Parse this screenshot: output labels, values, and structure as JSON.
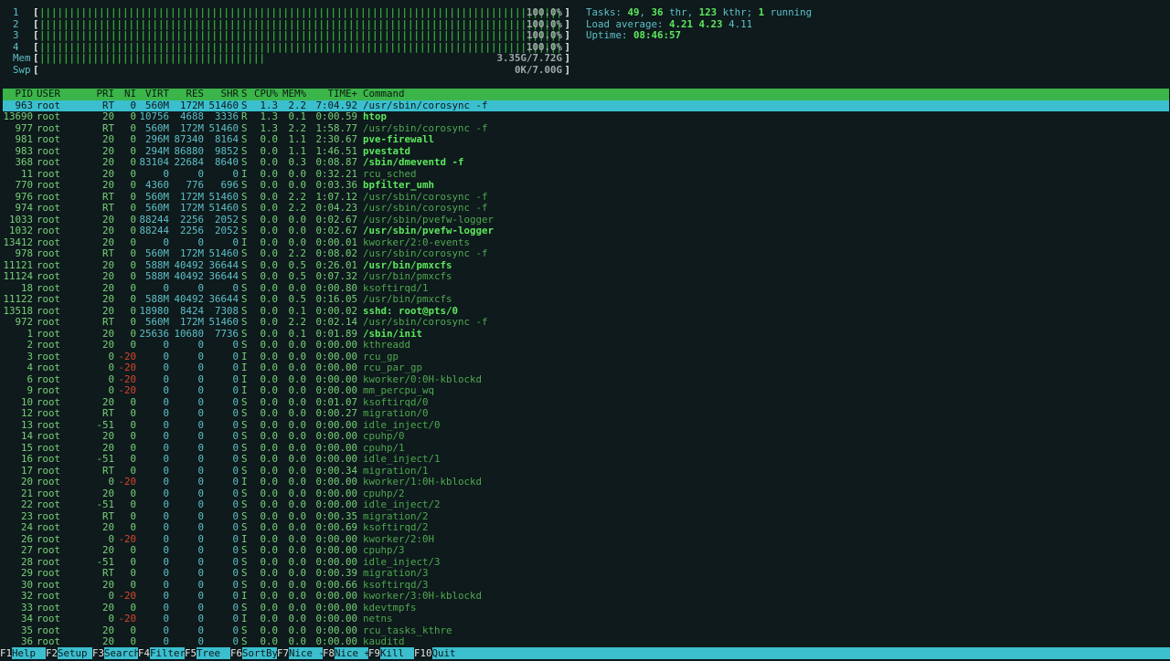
{
  "meters": [
    {
      "label": "1",
      "fraction": 1.0,
      "text": "100.0%",
      "bar_color": "#47d247"
    },
    {
      "label": "2",
      "fraction": 1.0,
      "text": "100.0%",
      "bar_color": "#47d247"
    },
    {
      "label": "3",
      "fraction": 1.0,
      "text": "100.0%",
      "bar_color": "#47d247"
    },
    {
      "label": "4",
      "fraction": 1.0,
      "text": "100.0%",
      "bar_color": "#47d247"
    },
    {
      "label": "Mem",
      "fraction": 0.434,
      "text": "3.35G/7.72G",
      "bar_color": "#47d247"
    },
    {
      "label": "Swp",
      "fraction": 0.0,
      "text": "0K/7.00G",
      "bar_color": "#d8452b"
    }
  ],
  "info": {
    "tasks_label": "Tasks: ",
    "tasks": "49",
    "thr_sep": ", ",
    "thr": "36",
    "thr_label": " thr, ",
    "kthr": "123",
    "kthr_label": " kthr; ",
    "running": "1",
    "running_label": " running",
    "load_label": "Load average: ",
    "load1": "4.21",
    "load5": "4.23",
    "load15": "4.11",
    "uptime_label": "Uptime: ",
    "uptime": "08:46:57"
  },
  "columns": {
    "pid": "PID",
    "user": "USER",
    "pri": "PRI",
    "ni": "NI",
    "virt": "VIRT",
    "res": "RES",
    "shr": "SHR",
    "s": "S",
    "cpu": "CPU%",
    "mem": "MEM%",
    "time": "TIME+",
    "cmd": "Command"
  },
  "processes": [
    {
      "pid": "963",
      "user": "root",
      "pri": "RT",
      "ni": "0",
      "virt": "560M",
      "res": "172M",
      "shr": "51460",
      "s": "S",
      "cpu": "1.3",
      "mem": "2.2",
      "time": "7:04.92",
      "cmd": "/usr/sbin/corosync -f",
      "style": "normal",
      "selected": true
    },
    {
      "pid": "13690",
      "user": "root",
      "pri": "20",
      "ni": "0",
      "virt": "10756",
      "res": "4688",
      "shr": "3336",
      "s": "R",
      "cpu": "1.3",
      "mem": "0.1",
      "time": "0:00.59",
      "cmd": "htop",
      "style": "bright"
    },
    {
      "pid": "977",
      "user": "root",
      "pri": "RT",
      "ni": "0",
      "virt": "560M",
      "res": "172M",
      "shr": "51460",
      "s": "S",
      "cpu": "1.3",
      "mem": "2.2",
      "time": "1:58.77",
      "cmd": "/usr/sbin/corosync -f",
      "style": "dim"
    },
    {
      "pid": "981",
      "user": "root",
      "pri": "20",
      "ni": "0",
      "virt": "296M",
      "res": "87340",
      "shr": "8164",
      "s": "S",
      "cpu": "0.0",
      "mem": "1.1",
      "time": "2:30.67",
      "cmd": "pve-firewall",
      "style": "bright"
    },
    {
      "pid": "983",
      "user": "root",
      "pri": "20",
      "ni": "0",
      "virt": "294M",
      "res": "86880",
      "shr": "9852",
      "s": "S",
      "cpu": "0.0",
      "mem": "1.1",
      "time": "1:46.51",
      "cmd": "pvestatd",
      "style": "bright"
    },
    {
      "pid": "368",
      "user": "root",
      "pri": "20",
      "ni": "0",
      "virt": "83104",
      "res": "22684",
      "shr": "8640",
      "s": "S",
      "cpu": "0.0",
      "mem": "0.3",
      "time": "0:08.87",
      "cmd": "/sbin/dmeventd -f",
      "style": "bright"
    },
    {
      "pid": "11",
      "user": "root",
      "pri": "20",
      "ni": "0",
      "virt": "0",
      "res": "0",
      "shr": "0",
      "s": "I",
      "cpu": "0.0",
      "mem": "0.0",
      "time": "0:32.21",
      "cmd": "rcu_sched",
      "style": "dim"
    },
    {
      "pid": "770",
      "user": "root",
      "pri": "20",
      "ni": "0",
      "virt": "4360",
      "res": "776",
      "shr": "696",
      "s": "S",
      "cpu": "0.0",
      "mem": "0.0",
      "time": "0:03.36",
      "cmd": "bpfilter_umh",
      "style": "bright"
    },
    {
      "pid": "976",
      "user": "root",
      "pri": "RT",
      "ni": "0",
      "virt": "560M",
      "res": "172M",
      "shr": "51460",
      "s": "S",
      "cpu": "0.0",
      "mem": "2.2",
      "time": "1:07.12",
      "cmd": "/usr/sbin/corosync -f",
      "style": "dim"
    },
    {
      "pid": "974",
      "user": "root",
      "pri": "RT",
      "ni": "0",
      "virt": "560M",
      "res": "172M",
      "shr": "51460",
      "s": "S",
      "cpu": "0.0",
      "mem": "2.2",
      "time": "0:04.23",
      "cmd": "/usr/sbin/corosync -f",
      "style": "dim"
    },
    {
      "pid": "1033",
      "user": "root",
      "pri": "20",
      "ni": "0",
      "virt": "88244",
      "res": "2256",
      "shr": "2052",
      "s": "S",
      "cpu": "0.0",
      "mem": "0.0",
      "time": "0:02.67",
      "cmd": "/usr/sbin/pvefw-logger",
      "style": "dim"
    },
    {
      "pid": "1032",
      "user": "root",
      "pri": "20",
      "ni": "0",
      "virt": "88244",
      "res": "2256",
      "shr": "2052",
      "s": "S",
      "cpu": "0.0",
      "mem": "0.0",
      "time": "0:02.67",
      "cmd": "/usr/sbin/pvefw-logger",
      "style": "bright"
    },
    {
      "pid": "13412",
      "user": "root",
      "pri": "20",
      "ni": "0",
      "virt": "0",
      "res": "0",
      "shr": "0",
      "s": "I",
      "cpu": "0.0",
      "mem": "0.0",
      "time": "0:00.01",
      "cmd": "kworker/2:0-events",
      "style": "dim"
    },
    {
      "pid": "978",
      "user": "root",
      "pri": "RT",
      "ni": "0",
      "virt": "560M",
      "res": "172M",
      "shr": "51460",
      "s": "S",
      "cpu": "0.0",
      "mem": "2.2",
      "time": "0:08.02",
      "cmd": "/usr/sbin/corosync -f",
      "style": "dim"
    },
    {
      "pid": "11121",
      "user": "root",
      "pri": "20",
      "ni": "0",
      "virt": "588M",
      "res": "40492",
      "shr": "36644",
      "s": "S",
      "cpu": "0.0",
      "mem": "0.5",
      "time": "0:26.01",
      "cmd": "/usr/bin/pmxcfs",
      "style": "bright"
    },
    {
      "pid": "11124",
      "user": "root",
      "pri": "20",
      "ni": "0",
      "virt": "588M",
      "res": "40492",
      "shr": "36644",
      "s": "S",
      "cpu": "0.0",
      "mem": "0.5",
      "time": "0:07.32",
      "cmd": "/usr/bin/pmxcfs",
      "style": "dim"
    },
    {
      "pid": "18",
      "user": "root",
      "pri": "20",
      "ni": "0",
      "virt": "0",
      "res": "0",
      "shr": "0",
      "s": "S",
      "cpu": "0.0",
      "mem": "0.0",
      "time": "0:00.80",
      "cmd": "ksoftirqd/1",
      "style": "dim"
    },
    {
      "pid": "11122",
      "user": "root",
      "pri": "20",
      "ni": "0",
      "virt": "588M",
      "res": "40492",
      "shr": "36644",
      "s": "S",
      "cpu": "0.0",
      "mem": "0.5",
      "time": "0:16.05",
      "cmd": "/usr/bin/pmxcfs",
      "style": "dim"
    },
    {
      "pid": "13518",
      "user": "root",
      "pri": "20",
      "ni": "0",
      "virt": "18980",
      "res": "8424",
      "shr": "7308",
      "s": "S",
      "cpu": "0.0",
      "mem": "0.1",
      "time": "0:00.02",
      "cmd": "sshd: root@pts/0",
      "style": "bright"
    },
    {
      "pid": "972",
      "user": "root",
      "pri": "RT",
      "ni": "0",
      "virt": "560M",
      "res": "172M",
      "shr": "51460",
      "s": "S",
      "cpu": "0.0",
      "mem": "2.2",
      "time": "0:02.14",
      "cmd": "/usr/sbin/corosync -f",
      "style": "dim"
    },
    {
      "pid": "1",
      "user": "root",
      "pri": "20",
      "ni": "0",
      "virt": "25636",
      "res": "10680",
      "shr": "7736",
      "s": "S",
      "cpu": "0.0",
      "mem": "0.1",
      "time": "0:01.89",
      "cmd": "/sbin/init",
      "style": "bright"
    },
    {
      "pid": "2",
      "user": "root",
      "pri": "20",
      "ni": "0",
      "virt": "0",
      "res": "0",
      "shr": "0",
      "s": "S",
      "cpu": "0.0",
      "mem": "0.0",
      "time": "0:00.00",
      "cmd": "kthreadd",
      "style": "dim"
    },
    {
      "pid": "3",
      "user": "root",
      "pri": "0",
      "ni": "-20",
      "virt": "0",
      "res": "0",
      "shr": "0",
      "s": "I",
      "cpu": "0.0",
      "mem": "0.0",
      "time": "0:00.00",
      "cmd": "rcu_gp",
      "style": "dim"
    },
    {
      "pid": "4",
      "user": "root",
      "pri": "0",
      "ni": "-20",
      "virt": "0",
      "res": "0",
      "shr": "0",
      "s": "I",
      "cpu": "0.0",
      "mem": "0.0",
      "time": "0:00.00",
      "cmd": "rcu_par_gp",
      "style": "dim"
    },
    {
      "pid": "6",
      "user": "root",
      "pri": "0",
      "ni": "-20",
      "virt": "0",
      "res": "0",
      "shr": "0",
      "s": "I",
      "cpu": "0.0",
      "mem": "0.0",
      "time": "0:00.00",
      "cmd": "kworker/0:0H-kblockd",
      "style": "dim"
    },
    {
      "pid": "9",
      "user": "root",
      "pri": "0",
      "ni": "-20",
      "virt": "0",
      "res": "0",
      "shr": "0",
      "s": "I",
      "cpu": "0.0",
      "mem": "0.0",
      "time": "0:00.00",
      "cmd": "mm_percpu_wq",
      "style": "dim"
    },
    {
      "pid": "10",
      "user": "root",
      "pri": "20",
      "ni": "0",
      "virt": "0",
      "res": "0",
      "shr": "0",
      "s": "S",
      "cpu": "0.0",
      "mem": "0.0",
      "time": "0:01.07",
      "cmd": "ksoftirqd/0",
      "style": "dim"
    },
    {
      "pid": "12",
      "user": "root",
      "pri": "RT",
      "ni": "0",
      "virt": "0",
      "res": "0",
      "shr": "0",
      "s": "S",
      "cpu": "0.0",
      "mem": "0.0",
      "time": "0:00.27",
      "cmd": "migration/0",
      "style": "dim"
    },
    {
      "pid": "13",
      "user": "root",
      "pri": "-51",
      "ni": "0",
      "virt": "0",
      "res": "0",
      "shr": "0",
      "s": "S",
      "cpu": "0.0",
      "mem": "0.0",
      "time": "0:00.00",
      "cmd": "idle_inject/0",
      "style": "dim"
    },
    {
      "pid": "14",
      "user": "root",
      "pri": "20",
      "ni": "0",
      "virt": "0",
      "res": "0",
      "shr": "0",
      "s": "S",
      "cpu": "0.0",
      "mem": "0.0",
      "time": "0:00.00",
      "cmd": "cpuhp/0",
      "style": "dim"
    },
    {
      "pid": "15",
      "user": "root",
      "pri": "20",
      "ni": "0",
      "virt": "0",
      "res": "0",
      "shr": "0",
      "s": "S",
      "cpu": "0.0",
      "mem": "0.0",
      "time": "0:00.00",
      "cmd": "cpuhp/1",
      "style": "dim"
    },
    {
      "pid": "16",
      "user": "root",
      "pri": "-51",
      "ni": "0",
      "virt": "0",
      "res": "0",
      "shr": "0",
      "s": "S",
      "cpu": "0.0",
      "mem": "0.0",
      "time": "0:00.00",
      "cmd": "idle_inject/1",
      "style": "dim"
    },
    {
      "pid": "17",
      "user": "root",
      "pri": "RT",
      "ni": "0",
      "virt": "0",
      "res": "0",
      "shr": "0",
      "s": "S",
      "cpu": "0.0",
      "mem": "0.0",
      "time": "0:00.34",
      "cmd": "migration/1",
      "style": "dim"
    },
    {
      "pid": "20",
      "user": "root",
      "pri": "0",
      "ni": "-20",
      "virt": "0",
      "res": "0",
      "shr": "0",
      "s": "I",
      "cpu": "0.0",
      "mem": "0.0",
      "time": "0:00.00",
      "cmd": "kworker/1:0H-kblockd",
      "style": "dim"
    },
    {
      "pid": "21",
      "user": "root",
      "pri": "20",
      "ni": "0",
      "virt": "0",
      "res": "0",
      "shr": "0",
      "s": "S",
      "cpu": "0.0",
      "mem": "0.0",
      "time": "0:00.00",
      "cmd": "cpuhp/2",
      "style": "dim"
    },
    {
      "pid": "22",
      "user": "root",
      "pri": "-51",
      "ni": "0",
      "virt": "0",
      "res": "0",
      "shr": "0",
      "s": "S",
      "cpu": "0.0",
      "mem": "0.0",
      "time": "0:00.00",
      "cmd": "idle_inject/2",
      "style": "dim"
    },
    {
      "pid": "23",
      "user": "root",
      "pri": "RT",
      "ni": "0",
      "virt": "0",
      "res": "0",
      "shr": "0",
      "s": "S",
      "cpu": "0.0",
      "mem": "0.0",
      "time": "0:00.35",
      "cmd": "migration/2",
      "style": "dim"
    },
    {
      "pid": "24",
      "user": "root",
      "pri": "20",
      "ni": "0",
      "virt": "0",
      "res": "0",
      "shr": "0",
      "s": "S",
      "cpu": "0.0",
      "mem": "0.0",
      "time": "0:00.69",
      "cmd": "ksoftirqd/2",
      "style": "dim"
    },
    {
      "pid": "26",
      "user": "root",
      "pri": "0",
      "ni": "-20",
      "virt": "0",
      "res": "0",
      "shr": "0",
      "s": "I",
      "cpu": "0.0",
      "mem": "0.0",
      "time": "0:00.00",
      "cmd": "kworker/2:0H",
      "style": "dim"
    },
    {
      "pid": "27",
      "user": "root",
      "pri": "20",
      "ni": "0",
      "virt": "0",
      "res": "0",
      "shr": "0",
      "s": "S",
      "cpu": "0.0",
      "mem": "0.0",
      "time": "0:00.00",
      "cmd": "cpuhp/3",
      "style": "dim"
    },
    {
      "pid": "28",
      "user": "root",
      "pri": "-51",
      "ni": "0",
      "virt": "0",
      "res": "0",
      "shr": "0",
      "s": "S",
      "cpu": "0.0",
      "mem": "0.0",
      "time": "0:00.00",
      "cmd": "idle_inject/3",
      "style": "dim"
    },
    {
      "pid": "29",
      "user": "root",
      "pri": "RT",
      "ni": "0",
      "virt": "0",
      "res": "0",
      "shr": "0",
      "s": "S",
      "cpu": "0.0",
      "mem": "0.0",
      "time": "0:00.39",
      "cmd": "migration/3",
      "style": "dim"
    },
    {
      "pid": "30",
      "user": "root",
      "pri": "20",
      "ni": "0",
      "virt": "0",
      "res": "0",
      "shr": "0",
      "s": "S",
      "cpu": "0.0",
      "mem": "0.0",
      "time": "0:00.66",
      "cmd": "ksoftirqd/3",
      "style": "dim"
    },
    {
      "pid": "32",
      "user": "root",
      "pri": "0",
      "ni": "-20",
      "virt": "0",
      "res": "0",
      "shr": "0",
      "s": "I",
      "cpu": "0.0",
      "mem": "0.0",
      "time": "0:00.00",
      "cmd": "kworker/3:0H-kblockd",
      "style": "dim"
    },
    {
      "pid": "33",
      "user": "root",
      "pri": "20",
      "ni": "0",
      "virt": "0",
      "res": "0",
      "shr": "0",
      "s": "S",
      "cpu": "0.0",
      "mem": "0.0",
      "time": "0:00.00",
      "cmd": "kdevtmpfs",
      "style": "dim"
    },
    {
      "pid": "34",
      "user": "root",
      "pri": "0",
      "ni": "-20",
      "virt": "0",
      "res": "0",
      "shr": "0",
      "s": "I",
      "cpu": "0.0",
      "mem": "0.0",
      "time": "0:00.00",
      "cmd": "netns",
      "style": "dim"
    },
    {
      "pid": "35",
      "user": "root",
      "pri": "20",
      "ni": "0",
      "virt": "0",
      "res": "0",
      "shr": "0",
      "s": "S",
      "cpu": "0.0",
      "mem": "0.0",
      "time": "0:00.00",
      "cmd": "rcu_tasks_kthre",
      "style": "dim"
    },
    {
      "pid": "36",
      "user": "root",
      "pri": "20",
      "ni": "0",
      "virt": "0",
      "res": "0",
      "shr": "0",
      "s": "S",
      "cpu": "0.0",
      "mem": "0.0",
      "time": "0:00.00",
      "cmd": "kauditd",
      "style": "dim"
    }
  ],
  "fkeys": [
    {
      "key": "F1",
      "label": "Help"
    },
    {
      "key": "F2",
      "label": "Setup"
    },
    {
      "key": "F3",
      "label": "Search"
    },
    {
      "key": "F4",
      "label": "Filter"
    },
    {
      "key": "F5",
      "label": "Tree"
    },
    {
      "key": "F6",
      "label": "SortBy"
    },
    {
      "key": "F7",
      "label": "Nice -"
    },
    {
      "key": "F8",
      "label": "Nice +"
    },
    {
      "key": "F9",
      "label": "Kill"
    },
    {
      "key": "F10",
      "label": "Quit"
    }
  ],
  "colors": {
    "background": "#0e1a1c",
    "header_bar": "#3bb54a",
    "selection": "#3bbfcf",
    "footer_bar": "#3bbfcf",
    "negative_nice": "#d8452b"
  }
}
